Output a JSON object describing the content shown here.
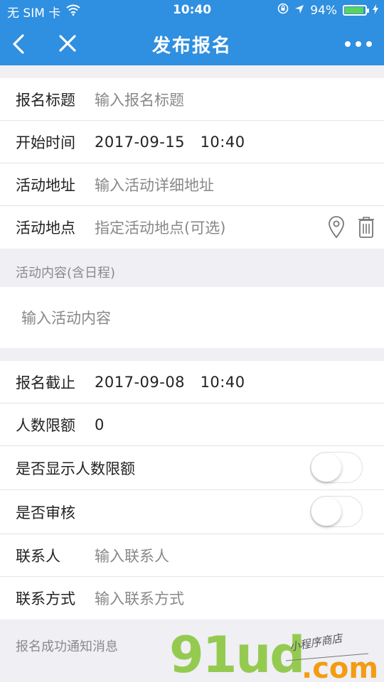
{
  "status_bar": {
    "carrier": "无 SIM 卡",
    "time": "10:40",
    "battery_percent": "94%",
    "battery_level": 0.94,
    "icons": [
      "wifi-icon",
      "orientation-lock-icon",
      "location-arrow-icon",
      "battery-icon",
      "charging-icon"
    ]
  },
  "nav": {
    "title": "发布报名",
    "back_icon": "chevron-left-icon",
    "close_icon": "close-icon",
    "more_icon": "more-dots-icon"
  },
  "form_top": [
    {
      "label": "报名标题",
      "placeholder": "输入报名标题"
    },
    {
      "label": "开始时间",
      "value": "2017-09-15   10:40"
    },
    {
      "label": "活动地址",
      "placeholder": "输入活动详细地址"
    },
    {
      "label": "活动地点",
      "placeholder": "指定活动地点(可选)"
    }
  ],
  "content_section": {
    "title": "活动内容(含日程)",
    "placeholder": "输入活动内容"
  },
  "form_bottom": [
    {
      "label": "报名截止",
      "value": "2017-09-08   10:40"
    },
    {
      "label": "人数限额",
      "value": "0"
    },
    {
      "label": "是否显示人数限额",
      "toggle": false
    },
    {
      "label": "是否审核",
      "toggle": false
    },
    {
      "label": "联系人",
      "placeholder": "输入联系人"
    },
    {
      "label": "联系方式",
      "placeholder": "输入联系方式"
    }
  ],
  "notify_section": {
    "title": "报名成功通知消息"
  },
  "watermark": {
    "brand": "91ud",
    "tagline": "小程序商店",
    "suffix": ".com"
  },
  "colors": {
    "accent": "#2f8fe0",
    "background": "#efeff4",
    "watermark_green": "#8cc63f",
    "watermark_orange": "#f39c12"
  }
}
